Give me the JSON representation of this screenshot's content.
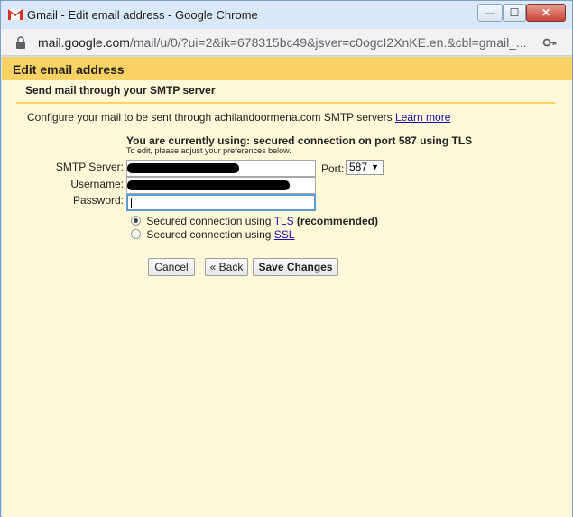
{
  "window": {
    "title": "Gmail - Edit email address - Google Chrome",
    "minimize_glyph": "—",
    "maximize_glyph": "☐",
    "close_glyph": "✕"
  },
  "addressbar": {
    "url_host": "mail.google.com",
    "url_rest": "/mail/u/0/?ui=2&ik=678315bc49&jsver=c0ogcI2XnKE.en.&cbl=gmail_..."
  },
  "dialog": {
    "header": "Edit email address",
    "subheader": "Send mail through your SMTP server",
    "intro_text": "Configure your mail to be sent through achilandoormena.com SMTP servers",
    "learn_more": "Learn more",
    "status": "You are currently using: secured connection on port 587 using TLS",
    "status_sub": "To edit, please adjust your preferences below.",
    "fields": {
      "server_label": "SMTP Server:",
      "username_label": "Username:",
      "password_label": "Password:",
      "port_label": "Port:",
      "port_value": "587"
    },
    "security": {
      "tls_prefix": "Secured connection using",
      "tls_link": "TLS",
      "tls_suffix": "(recommended)",
      "ssl_prefix": "Secured connection using",
      "ssl_link": "SSL",
      "selected": "TLS"
    },
    "buttons": {
      "cancel": "Cancel",
      "back": "« Back",
      "save": "Save Changes"
    }
  },
  "colors": {
    "header_bg": "#fad163",
    "page_bg": "#fff8d9",
    "link": "#1a0dab",
    "focus_border": "#5b9bd5"
  },
  "icons": {
    "app_logo": "gmail-icon",
    "secure": "lock-icon",
    "password_manager": "key-icon",
    "port_dropdown": "chevron-down-icon"
  }
}
